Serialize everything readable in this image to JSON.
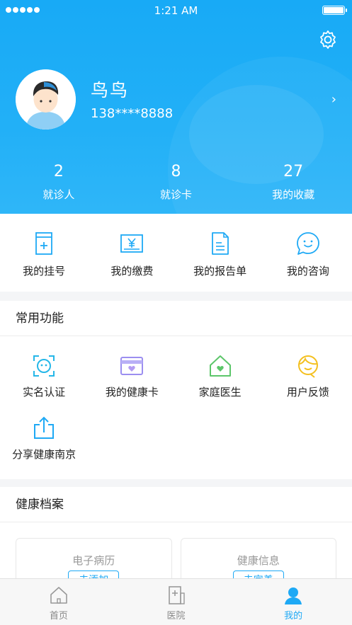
{
  "status_bar": {
    "time": "1:21 AM"
  },
  "profile": {
    "name": "鸟鸟",
    "phone": "138****8888"
  },
  "stats": [
    {
      "value": "2",
      "label": "就诊人"
    },
    {
      "value": "8",
      "label": "就诊卡"
    },
    {
      "value": "27",
      "label": "我的收藏"
    }
  ],
  "quick_actions": [
    {
      "label": "我的挂号",
      "icon": "registration-icon"
    },
    {
      "label": "我的缴费",
      "icon": "payment-icon"
    },
    {
      "label": "我的报告单",
      "icon": "report-icon"
    },
    {
      "label": "我的咨询",
      "icon": "consult-icon"
    }
  ],
  "common": {
    "title": "常用功能",
    "items": [
      {
        "label": "实名认证",
        "icon": "face-scan-icon"
      },
      {
        "label": "我的健康卡",
        "icon": "health-card-icon"
      },
      {
        "label": "家庭医生",
        "icon": "home-heart-icon"
      },
      {
        "label": "用户反馈",
        "icon": "feedback-icon"
      },
      {
        "label": "分享健康南京",
        "icon": "share-icon"
      }
    ]
  },
  "health_records": {
    "title": "健康档案",
    "cards": [
      {
        "title": "电子病历",
        "button": "去添加"
      },
      {
        "title": "健康信息",
        "button": "去完善"
      }
    ]
  },
  "tabbar": [
    {
      "label": "首页",
      "icon": "home-icon"
    },
    {
      "label": "医院",
      "icon": "hospital-icon"
    },
    {
      "label": "我的",
      "icon": "profile-icon",
      "active": true
    }
  ],
  "colors": {
    "primary": "#1ea9f5",
    "header_bg": "#22b0f7"
  }
}
